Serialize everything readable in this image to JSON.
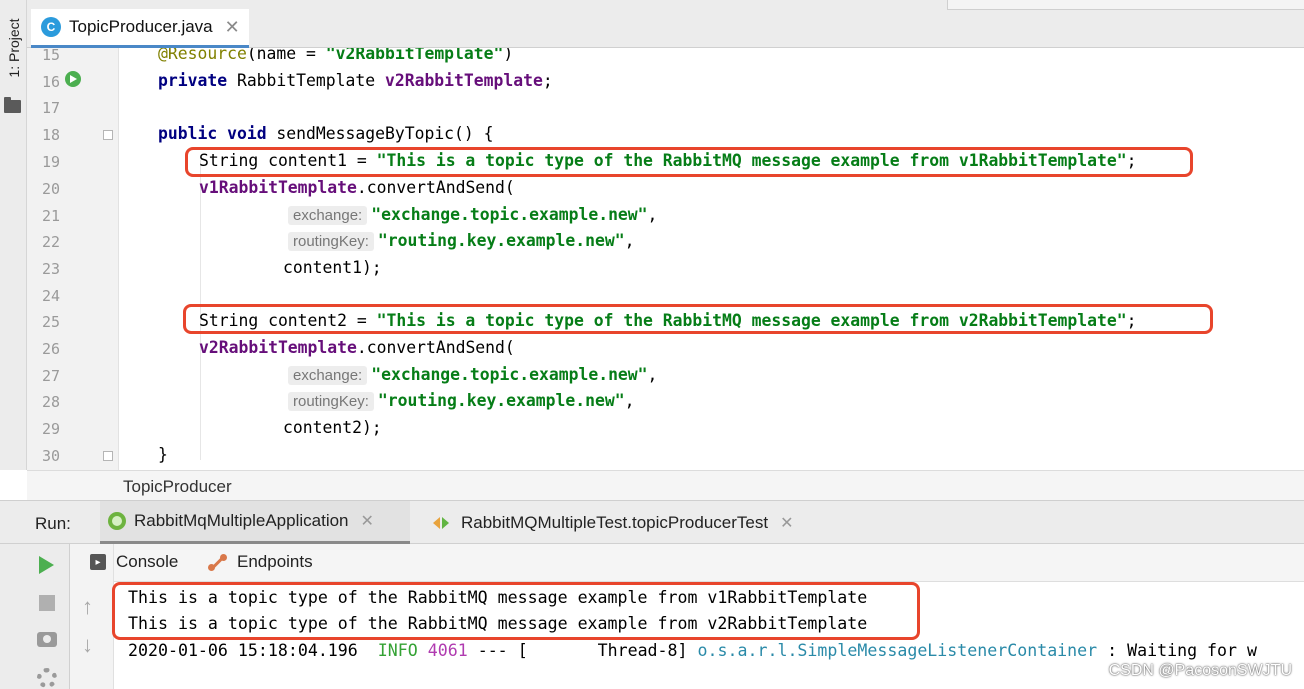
{
  "window": {
    "project_tool_label": "1: Project"
  },
  "editor_tab": {
    "icon_letter": "C",
    "label": "TopicProducer.java",
    "close": "✕"
  },
  "code": {
    "lines": [
      {
        "num": "15"
      },
      {
        "num": "16"
      },
      {
        "num": "17"
      },
      {
        "num": "18"
      },
      {
        "num": "19"
      },
      {
        "num": "20"
      },
      {
        "num": "21"
      },
      {
        "num": "22"
      },
      {
        "num": "23"
      },
      {
        "num": "24"
      },
      {
        "num": "25"
      },
      {
        "num": "26"
      },
      {
        "num": "27"
      },
      {
        "num": "28"
      },
      {
        "num": "29"
      },
      {
        "num": "30"
      }
    ],
    "l15_ann": "@Resource",
    "l15_mid": "(name = ",
    "l15_str": "\"v2RabbitTemplate\"",
    "l15_end": ")",
    "l16_kw": "private",
    "l16_type": " RabbitTemplate ",
    "l16_field": "v2RabbitTemplate",
    "l16_end": ";",
    "l18_kw1": "public",
    "l18_kw2": " void",
    "l18_rest": " sendMessageByTopic() {",
    "l19_pre": "String content1 = ",
    "l19_str": "\"This is a topic type of the RabbitMQ message example from v1RabbitTemplate\"",
    "l19_end": ";",
    "l20_field": "v1RabbitTemplate",
    "l20_rest": ".convertAndSend(",
    "hint_exchange": "exchange:",
    "hint_routing": "routingKey:",
    "str_exchange": "\"exchange.topic.example.new\"",
    "str_routing": "\"routing.key.example.new\"",
    "comma": ",",
    "l23": "content1);",
    "l25_pre": "String content2 = ",
    "l25_str": "\"This is a topic type of the RabbitMQ message example from v2RabbitTemplate\"",
    "l25_end": ";",
    "l26_field": "v2RabbitTemplate",
    "l26_rest": ".convertAndSend(",
    "l29": "content2);",
    "l30": "}"
  },
  "breadcrumb": "TopicProducer",
  "run_panel": {
    "label": "Run:",
    "tabs": [
      {
        "label": "RabbitMqMultipleApplication",
        "close": "✕"
      },
      {
        "label": "RabbitMQMultipleTest.topicProducerTest",
        "close": "✕"
      }
    ],
    "console_tab": "Console",
    "endpoints_tab": "Endpoints",
    "up_arrow": "↑",
    "down_arrow": "↓"
  },
  "console": {
    "line1": "This is a topic type of the RabbitMQ message example from v1RabbitTemplate",
    "line2": "This is a topic type of the RabbitMQ message example from v2RabbitTemplate",
    "log_time": "2020-01-06 15:18:04.196",
    "log_level": "INFO",
    "log_pid": "4061",
    "log_sep": "---",
    "log_thread": "[       Thread-8]",
    "log_logger": "o.s.a.r.l.SimpleMessageListenerContainer",
    "log_msg": ": Waiting for w"
  },
  "watermark": "CSDN @PacosonSWJTU",
  "colors": {
    "highlight_box": "#e8452c",
    "keyword": "#000080",
    "field": "#660e7a",
    "string": "#067d17",
    "annotation": "#808000"
  }
}
